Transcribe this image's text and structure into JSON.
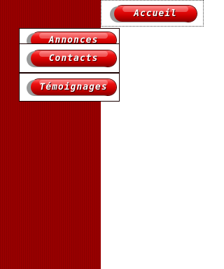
{
  "nav": {
    "items": [
      {
        "label": "Accueil"
      },
      {
        "label": "Annonces"
      },
      {
        "label": "Contacts"
      },
      {
        "label": "Témoignages"
      }
    ]
  },
  "colors": {
    "sidebar": "#990000",
    "button": "#cc0000",
    "button_text": "#ffffff"
  }
}
